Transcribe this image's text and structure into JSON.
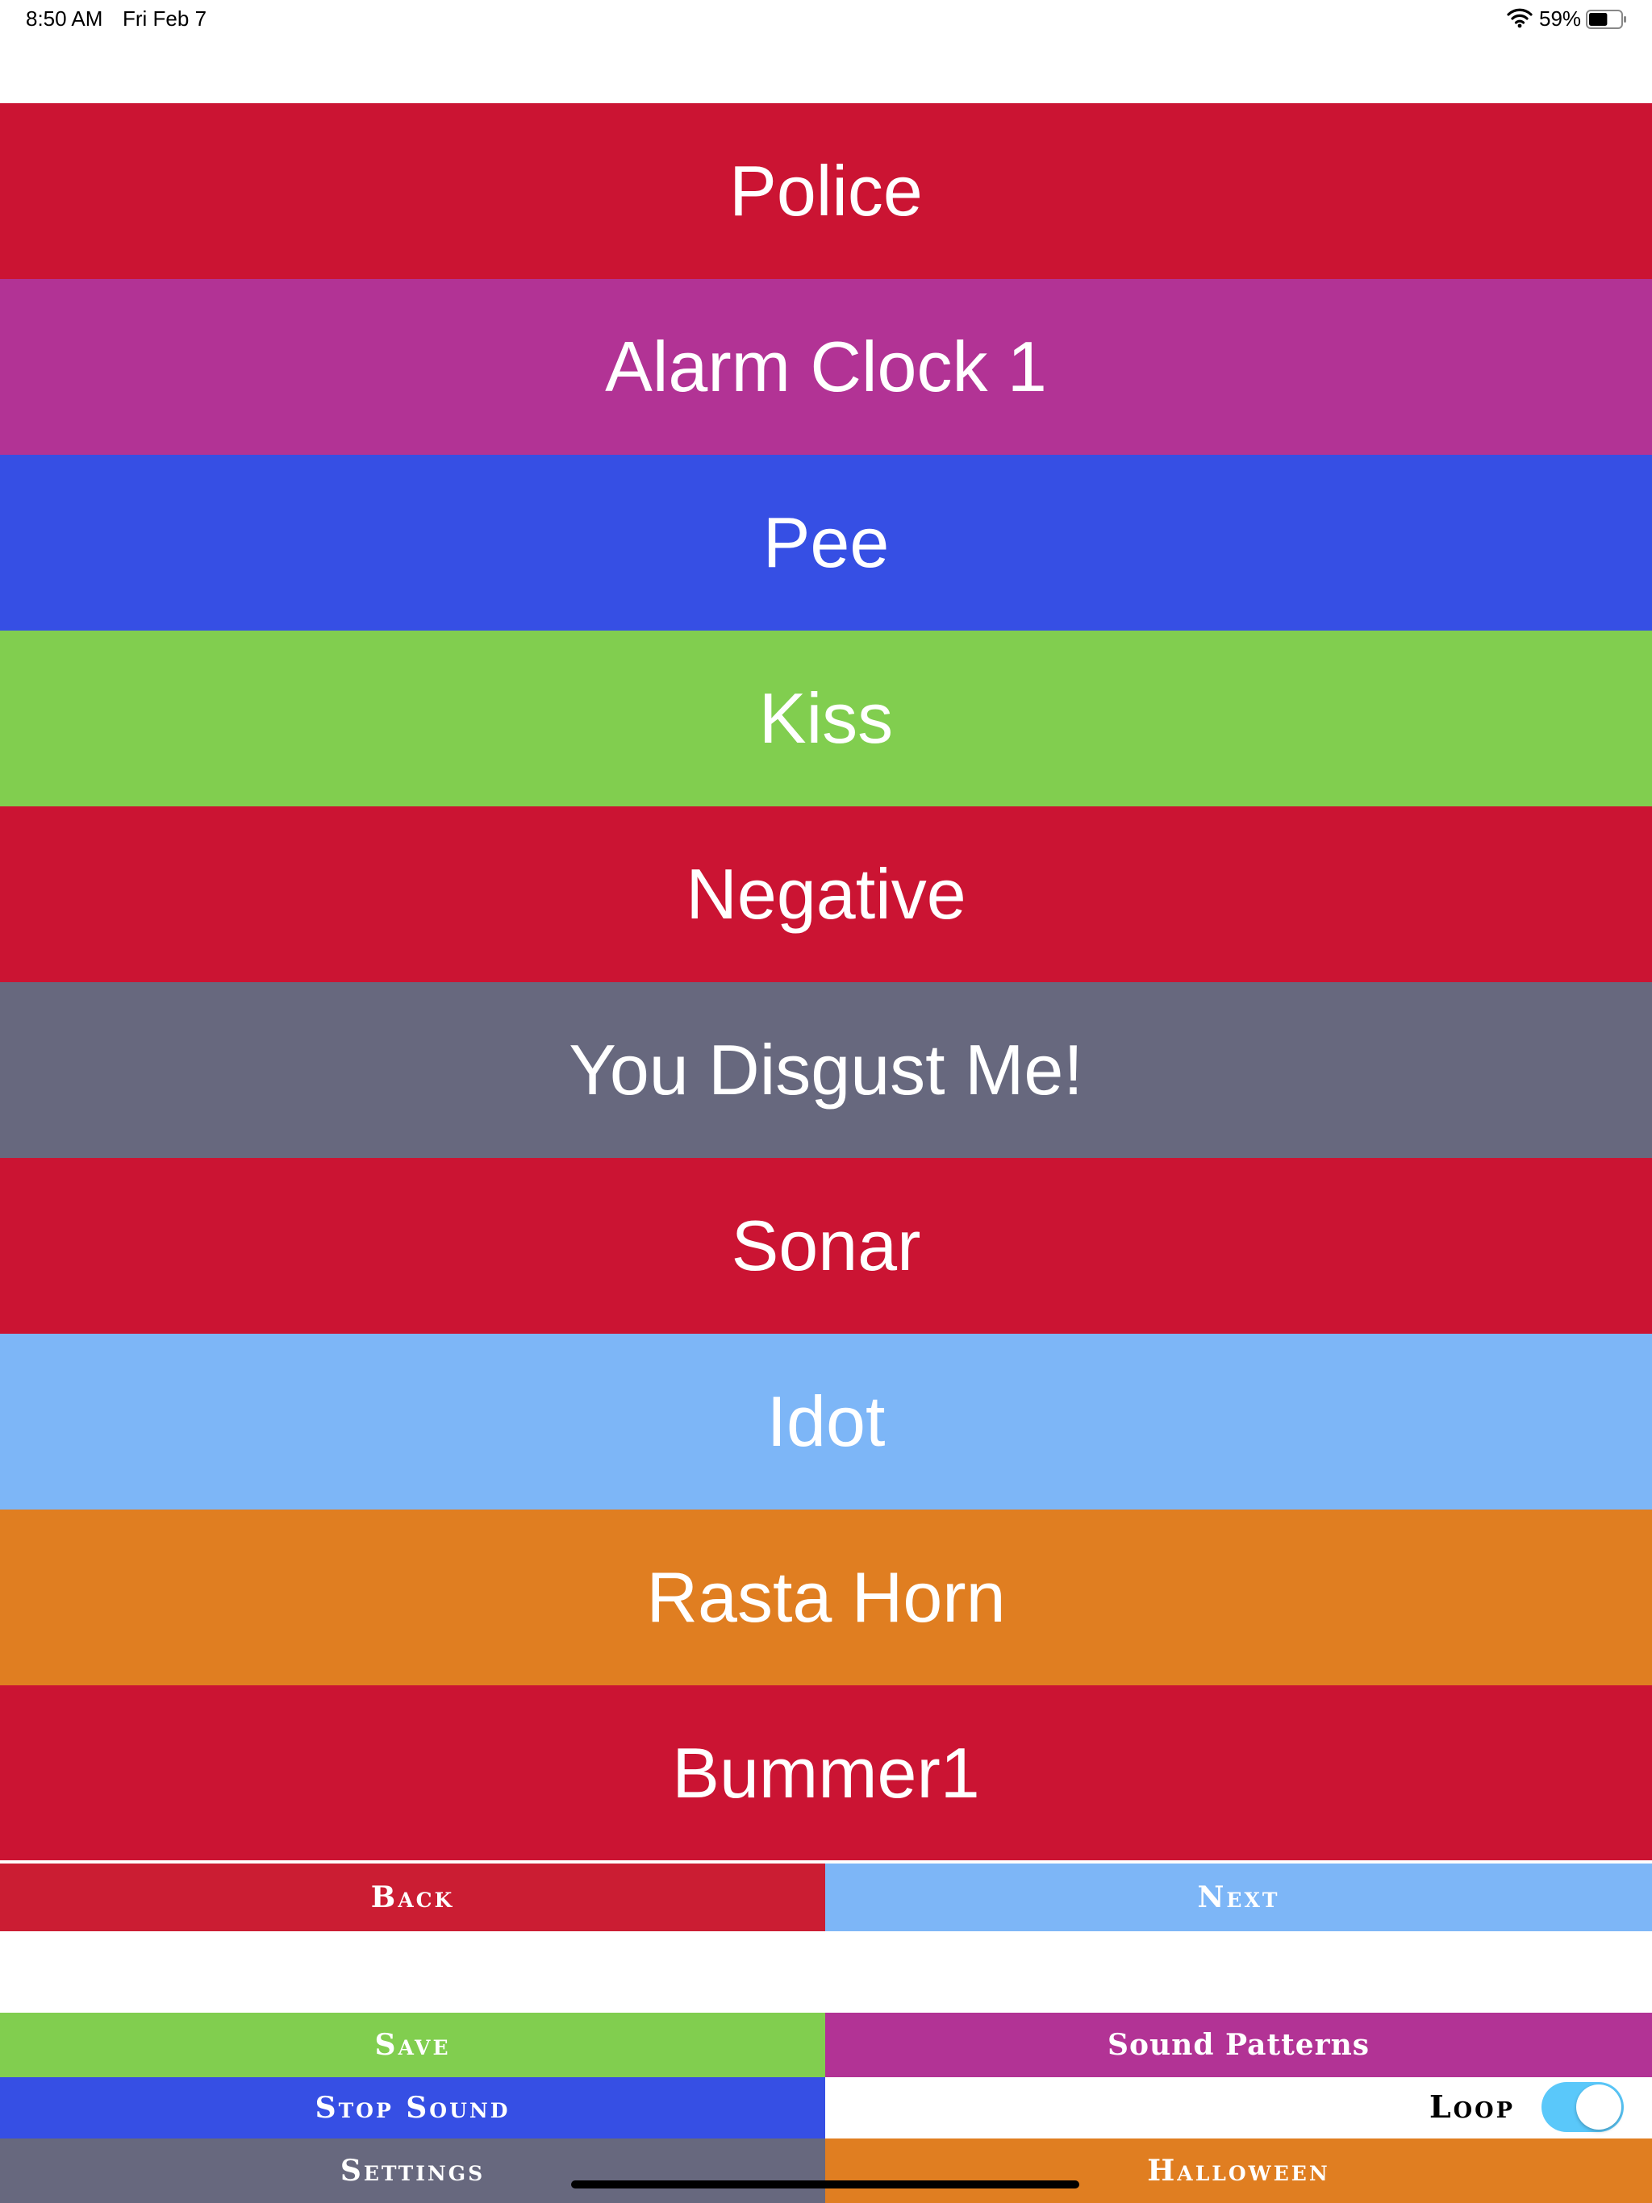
{
  "status_bar": {
    "time": "8:50 AM",
    "date": "Fri Feb 7",
    "battery_percent": "59%",
    "battery_level": 0.59,
    "icons": [
      "wifi-icon",
      "battery-icon"
    ]
  },
  "sounds": [
    {
      "label": "Police",
      "color": "#cb1433"
    },
    {
      "label": "Alarm Clock 1",
      "color": "#b23395"
    },
    {
      "label": "Pee",
      "color": "#364fe4"
    },
    {
      "label": "Kiss",
      "color": "#81ce4f"
    },
    {
      "label": "Negative",
      "color": "#cb1433"
    },
    {
      "label": "You Disgust Me!",
      "color": "#67687e"
    },
    {
      "label": "Sonar",
      "color": "#cb1433"
    },
    {
      "label": "Idot",
      "color": "#7db6f7"
    },
    {
      "label": "Rasta Horn",
      "color": "#e07e21"
    },
    {
      "label": "Bummer1",
      "color": "#cb1433"
    }
  ],
  "pager": {
    "back": {
      "label": "Back",
      "color": "#cb1d33"
    },
    "next": {
      "label": "Next",
      "color": "#7db6f7"
    }
  },
  "bottom": {
    "save": {
      "label": "Save",
      "color": "#81ce4f"
    },
    "sound_patterns": {
      "label": "Sound Patterns",
      "color": "#b23395"
    },
    "stop_sound": {
      "label": "Stop Sound",
      "color": "#364fe4"
    },
    "loop": {
      "label": "Loop",
      "on": true,
      "color": "#5ac8fa"
    },
    "settings": {
      "label": "Settings",
      "color": "#67687e"
    },
    "halloween": {
      "label": "Halloween",
      "color": "#e07e21"
    }
  }
}
